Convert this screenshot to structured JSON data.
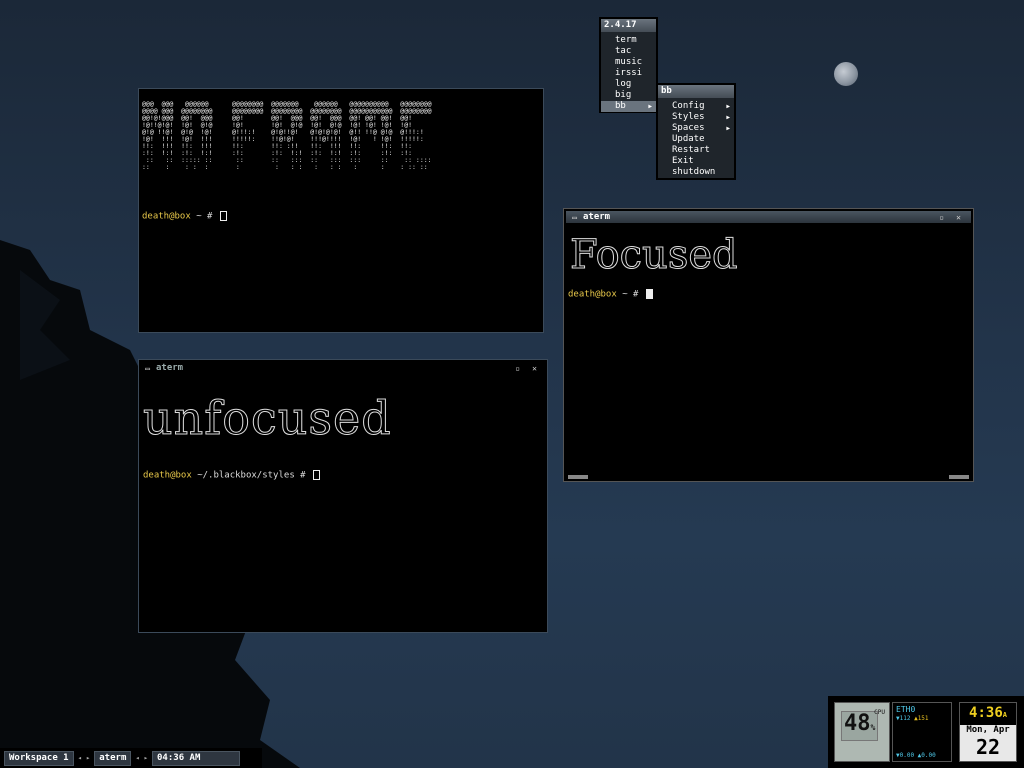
{
  "menu_main": {
    "title": "2.4.17",
    "items": [
      "term",
      "tac",
      "music",
      "irssi",
      "log",
      "big",
      "bb"
    ]
  },
  "menu_bb": {
    "title": "bb",
    "items": [
      "Config",
      "Styles",
      "Spaces",
      "Update",
      "Restart",
      "Exit",
      "shutdown"
    ]
  },
  "term_top": {
    "ascii_banner": "@@@  @@@   @@@@@@      @@@@@@@@  @@@@@@@    @@@@@@   @@@@@@@@@@   @@@@@@@@\n@@@@ @@@  @@@@@@@@     @@@@@@@@  @@@@@@@@  @@@@@@@@  @@@@@@@@@@@  @@@@@@@@\n@@!@!@@@  @@!  @@@     @@!       @@!  @@@  @@!  @@@  @@! @@! @@!  @@!\n!@!!@!@!  !@!  @!@     !@!       !@!  @!@  !@!  @!@  !@! !@! !@!  !@!\n@!@ !!@!  @!@  !@!     @!!!:!    @!@!!@!   @!@!@!@!  @!! !!@ @!@  @!!!:!\n!@!  !!!  !@!  !!!     !!!!!:    !!@!@!    !!!@!!!!  !@!   ! !@!  !!!!!:\n!!:  !!!  !!:  !!!     !!:       !!: :!!   !!:  !!!  !!:     !!:  !!:\n:!:  !:!  :!:  !:!     :!:       :!:  !:!  :!:  !:!  :!:     :!:  :!:\n ::   ::  ::::: ::      ::       ::   :::  ::   :::  :::     ::    :: ::::\n::    :    : :  :       :         :   : :   :   : :   :      :    : :: ::",
    "prompt_user": "death@box",
    "prompt_rest": " ~ # "
  },
  "term_focused": {
    "title": "aterm",
    "big_word": "Focused",
    "prompt_user": "death@box",
    "prompt_rest": " ~ # "
  },
  "term_unfocused": {
    "title": "aterm",
    "big_word": "unfocused",
    "prompt_user": "death@box",
    "prompt_rest": " ~/.blackbox/styles # "
  },
  "toolbar": {
    "workspace": "Workspace 1",
    "window": "aterm",
    "clock": "04:36 AM"
  },
  "dock": {
    "cpu_value": "48",
    "cpu_unit": "%",
    "cpu_label": "CPU",
    "net_label": "ETH0",
    "net_up": "▼112",
    "net_down": "▲151",
    "net_rates": "▼0.00  ▲0.00",
    "clock_time": "4:36",
    "clock_ampm": "A",
    "clock_day": "Mon, Apr",
    "clock_date": "22"
  }
}
